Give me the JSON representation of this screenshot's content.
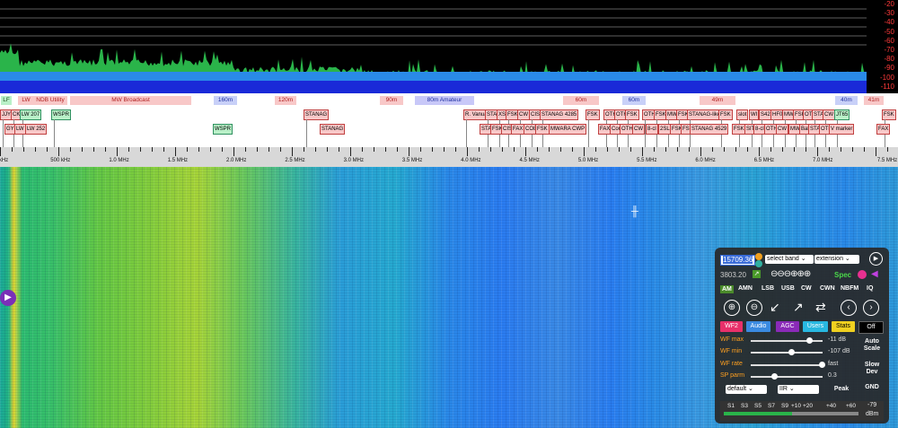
{
  "db_scale": [
    "-20",
    "-30",
    "-40",
    "-50",
    "-60",
    "-70",
    "-80",
    "-90",
    "-100",
    "-110"
  ],
  "bands": [
    {
      "label": "LF",
      "bg": "#b9f0c8",
      "color": "#205020"
    },
    {
      "label": "LW",
      "bg": "#f8c8c8",
      "color": "#b02020"
    },
    {
      "label": "NDB Utility",
      "bg": "#f8c8c8",
      "color": "#b02020"
    },
    {
      "label": "MW Broadcast",
      "bg": "#f8c8c8",
      "color": "#b02020"
    },
    {
      "label": "160m",
      "bg": "#c8d0f8",
      "color": "#2030a0"
    },
    {
      "label": "120m",
      "bg": "#f8c8c8",
      "color": "#b02020"
    },
    {
      "label": "90m",
      "bg": "#f8c8c8",
      "color": "#b02020"
    },
    {
      "label": "80m Amateur",
      "bg": "#c8c8f8",
      "color": "#2030a0"
    },
    {
      "label": "60m",
      "bg": "#f8c8c8",
      "color": "#b02020"
    },
    {
      "label": "60m",
      "bg": "#c8d0f8",
      "color": "#2030a0"
    },
    {
      "label": "49m",
      "bg": "#f8c8c8",
      "color": "#b02020"
    },
    {
      "label": "40m",
      "bg": "#c8d0f8",
      "color": "#2030a0"
    },
    {
      "label": "41m",
      "bg": "#f8c8c8",
      "color": "#b02020"
    }
  ],
  "stations_row1": [
    "JJY",
    "CKT",
    "LW 207",
    "WSPR",
    "STANAG",
    "R. Vanua",
    "STA",
    "XSC",
    "FSK",
    "CW",
    "CIS",
    "STANAG 4285",
    "FSK",
    "OTH",
    "OTH",
    "FSK",
    "OTH",
    "FSK",
    "MW",
    "FSK",
    "STANAG-like",
    "FSK",
    "slot",
    "WI",
    "S42",
    "HF0",
    "MW",
    "FSK",
    "OT",
    "STA",
    "CW",
    "JT65",
    "FSK"
  ],
  "stations_row2": [
    "GYN",
    "LW",
    "LW 252",
    "WSPR",
    "STANAG",
    "STA",
    "FSK",
    "CIS",
    "FAX",
    "CO8",
    "FSK",
    "MWARA CWP",
    "FAX",
    "Cor",
    "OTH",
    "CW",
    "8-cl",
    "2SL",
    "FSK",
    "FSK",
    "STANAG 4529",
    "FSK",
    "SIT",
    "8-cl",
    "OTH",
    "CW",
    "MW",
    "Bal",
    "STA",
    "OTH",
    "V marker",
    "FAX"
  ],
  "ruler_ticks": [
    "kHz",
    "500 kHz",
    "1.0 MHz",
    "1.5 MHz",
    "2.0 MHz",
    "2.5 MHz",
    "3.0 MHz",
    "3.5 MHz",
    "4.0 MHz",
    "4.5 MHz",
    "5.0 MHz",
    "5.5 MHz",
    "6.0 MHz",
    "6.5 MHz",
    "7.0 MHz",
    "7.5 MHz"
  ],
  "panel": {
    "freq": "15709.36",
    "select_band": "select band",
    "extension": "extension",
    "passband": "3803.20",
    "spec": "Spec",
    "modes": [
      "AM",
      "AMN",
      "LSB",
      "USB",
      "CW",
      "CWN",
      "NBFM",
      "IQ"
    ],
    "toggles": [
      {
        "label": "WF2",
        "bg": "#e8306a",
        "color": "#ffffff"
      },
      {
        "label": "Audio",
        "bg": "#3a8ae0",
        "color": "#ffffff"
      },
      {
        "label": "AGC",
        "bg": "#8a2ab8",
        "color": "#ffffff"
      },
      {
        "label": "Users",
        "bg": "#28b8e0",
        "color": "#ffffff"
      },
      {
        "label": "Stats",
        "bg": "#f0d020",
        "color": "#000000"
      },
      {
        "label": "Off",
        "bg": "#000000",
        "color": "#ffffff"
      }
    ],
    "sliders": [
      {
        "label": "WF max",
        "value": "-11 dB",
        "level": 0.82
      },
      {
        "label": "WF min",
        "value": "-107 dB",
        "level": 0.55
      },
      {
        "label": "WF rate",
        "value": "fast",
        "level": 1.0
      },
      {
        "label": "SP parm",
        "value": "0.3",
        "level": 0.3
      }
    ],
    "right_buttons": [
      "Auto\nScale",
      "Slow\nDev",
      "Peak",
      "GND"
    ],
    "sel_default": "default",
    "sel_iir": "IIR",
    "smeter_labels": [
      "S1",
      "S3",
      "S5",
      "S7",
      "S9",
      "+10",
      "+20",
      "+40",
      "+60"
    ],
    "smeter_value": "-79",
    "smeter_unit": "dBm"
  }
}
